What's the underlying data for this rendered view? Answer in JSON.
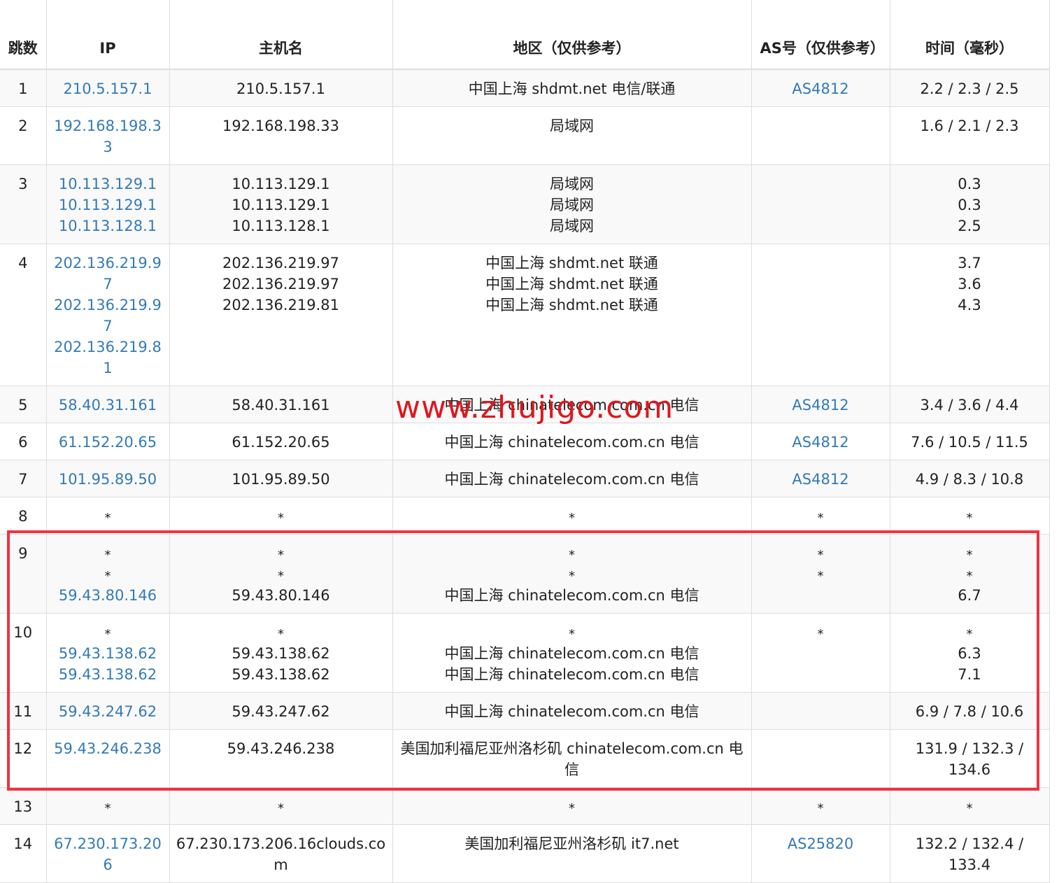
{
  "headers": {
    "hop": "跳数",
    "ip": "IP",
    "host": "主机名",
    "region": "地区（仅供参考）",
    "as": "AS号（仅供参考）",
    "time": "时间（毫秒）"
  },
  "watermark": "www.zhujigo.com",
  "colors": {
    "link": "#337ab7",
    "watermark": "#e0161d",
    "highlight_border": "#ee3340",
    "row_stripe": "#f9f9f9",
    "grid": "#dddddd"
  },
  "highlighted_hops": [
    "9",
    "10",
    "11",
    "12"
  ],
  "rows": [
    {
      "hop": "1",
      "lines": [
        {
          "ip": "210.5.157.1",
          "host": "210.5.157.1",
          "region": "中国上海 shdmt.net 电信/联通",
          "as": "AS4812",
          "time": "2.2 / 2.3 / 2.5"
        }
      ]
    },
    {
      "hop": "2",
      "lines": [
        {
          "ip": "192.168.198.33",
          "host": "192.168.198.33",
          "region": "局域网",
          "as": "",
          "time": "1.6 / 2.1 / 2.3"
        }
      ]
    },
    {
      "hop": "3",
      "lines": [
        {
          "ip": "10.113.129.1",
          "host": "10.113.129.1",
          "region": "局域网",
          "as": "",
          "time": "0.3"
        },
        {
          "ip": "10.113.129.1",
          "host": "10.113.129.1",
          "region": "局域网",
          "as": "",
          "time": "0.3"
        },
        {
          "ip": "10.113.128.1",
          "host": "10.113.128.1",
          "region": "局域网",
          "as": "",
          "time": "2.5"
        }
      ]
    },
    {
      "hop": "4",
      "lines": [
        {
          "ip": "202.136.219.97",
          "host": "202.136.219.97",
          "region": "中国上海 shdmt.net 联通",
          "as": "",
          "time": "3.7"
        },
        {
          "ip": "202.136.219.97",
          "host": "202.136.219.97",
          "region": "中国上海 shdmt.net 联通",
          "as": "",
          "time": "3.6"
        },
        {
          "ip": "202.136.219.81",
          "host": "202.136.219.81",
          "region": "中国上海 shdmt.net 联通",
          "as": "",
          "time": "4.3"
        }
      ]
    },
    {
      "hop": "5",
      "lines": [
        {
          "ip": "58.40.31.161",
          "host": "58.40.31.161",
          "region": "中国上海 chinatelecom.com.cn 电信",
          "as": "AS4812",
          "time": "3.4 / 3.6 / 4.4"
        }
      ]
    },
    {
      "hop": "6",
      "lines": [
        {
          "ip": "61.152.20.65",
          "host": "61.152.20.65",
          "region": "中国上海 chinatelecom.com.cn 电信",
          "as": "AS4812",
          "time": "7.6 / 10.5 / 11.5"
        }
      ]
    },
    {
      "hop": "7",
      "lines": [
        {
          "ip": "101.95.89.50",
          "host": "101.95.89.50",
          "region": "中国上海 chinatelecom.com.cn 电信",
          "as": "AS4812",
          "time": "4.9 / 8.3 / 10.8"
        }
      ]
    },
    {
      "hop": "8",
      "lines": [
        {
          "ip": "*",
          "host": "*",
          "region": "*",
          "as": "*",
          "time": "*"
        }
      ]
    },
    {
      "hop": "9",
      "lines": [
        {
          "ip": "*",
          "host": "*",
          "region": "*",
          "as": "*",
          "time": "*"
        },
        {
          "ip": "*",
          "host": "*",
          "region": "*",
          "as": "*",
          "time": "*"
        },
        {
          "ip": "59.43.80.146",
          "host": "59.43.80.146",
          "region": "中国上海 chinatelecom.com.cn 电信",
          "as": "",
          "time": "6.7"
        }
      ]
    },
    {
      "hop": "10",
      "lines": [
        {
          "ip": "*",
          "host": "*",
          "region": "*",
          "as": "*",
          "time": "*"
        },
        {
          "ip": "59.43.138.62",
          "host": "59.43.138.62",
          "region": "中国上海 chinatelecom.com.cn 电信",
          "as": "",
          "time": "6.3"
        },
        {
          "ip": "59.43.138.62",
          "host": "59.43.138.62",
          "region": "中国上海 chinatelecom.com.cn 电信",
          "as": "",
          "time": "7.1"
        }
      ]
    },
    {
      "hop": "11",
      "lines": [
        {
          "ip": "59.43.247.62",
          "host": "59.43.247.62",
          "region": "中国上海 chinatelecom.com.cn 电信",
          "as": "",
          "time": "6.9 / 7.8 / 10.6"
        }
      ]
    },
    {
      "hop": "12",
      "lines": [
        {
          "ip": "59.43.246.238",
          "host": "59.43.246.238",
          "region": "美国加利福尼亚州洛杉矶 chinatelecom.com.cn 电信",
          "as": "",
          "time": "131.9 / 132.3 / 134.6"
        }
      ]
    },
    {
      "hop": "13",
      "lines": [
        {
          "ip": "*",
          "host": "*",
          "region": "*",
          "as": "*",
          "time": "*"
        }
      ]
    },
    {
      "hop": "14",
      "lines": [
        {
          "ip": "67.230.173.206",
          "host": "67.230.173.206.16clouds.com",
          "region": "美国加利福尼亚州洛杉矶 it7.net",
          "as": "AS25820",
          "time": "132.2 / 132.4 / 133.4"
        }
      ]
    }
  ]
}
